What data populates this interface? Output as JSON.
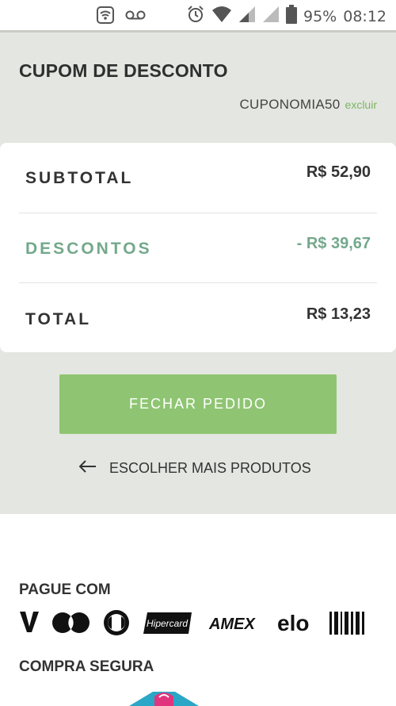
{
  "status_bar": {
    "battery": "95%",
    "time": "08:12"
  },
  "coupon": {
    "title": "CUPOM DE DESCONTO",
    "code": "CUPONOMIA50",
    "remove_label": "excluir"
  },
  "summary": {
    "subtotal_label": "SUBTOTAL",
    "subtotal_value": "R$ 52,90",
    "discount_label": "DESCONTOS",
    "discount_value": "- R$ 39,67",
    "total_label": "TOTAL",
    "total_value": "R$ 13,23"
  },
  "actions": {
    "checkout_label": "FECHAR PEDIDO",
    "continue_label": "ESCOLHER MAIS PRODUTOS"
  },
  "payment": {
    "title": "PAGUE COM",
    "methods": [
      "Visa",
      "Mastercard",
      "Diners",
      "Hipercard",
      "AMEX",
      "elo",
      "Boleto"
    ],
    "hipercard_text": "Hipercard",
    "amex_text": "AMEX",
    "elo_text": "elo"
  },
  "security": {
    "title": "COMPRA SEGURA"
  },
  "colors": {
    "accent_green": "#8fc572",
    "discount_green": "#74a88b",
    "panel_gray": "#e4e6e1"
  }
}
